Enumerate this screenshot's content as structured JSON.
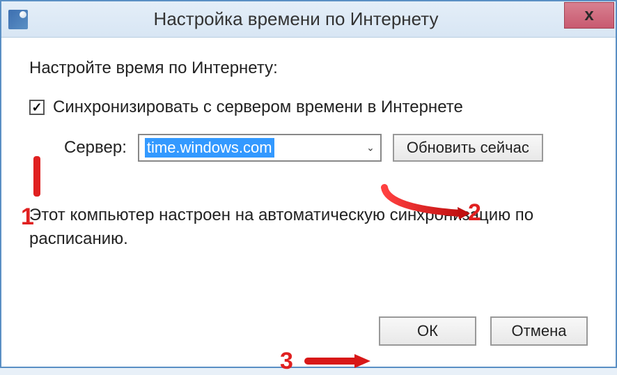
{
  "window": {
    "title": "Настройка времени по Интернету"
  },
  "content": {
    "instruction": "Настройте время по Интернету:",
    "checkbox_label": "Синхронизировать с сервером времени в Интернете",
    "server_label": "Сервер:",
    "server_value": "time.windows.com",
    "update_button": "Обновить сейчас",
    "status": "Этот компьютер настроен на автоматическую синхронизацию по расписанию."
  },
  "buttons": {
    "ok": "ОК",
    "cancel": "Отмена"
  },
  "annotations": {
    "n1": "1",
    "n2": "2",
    "n3": "3"
  }
}
